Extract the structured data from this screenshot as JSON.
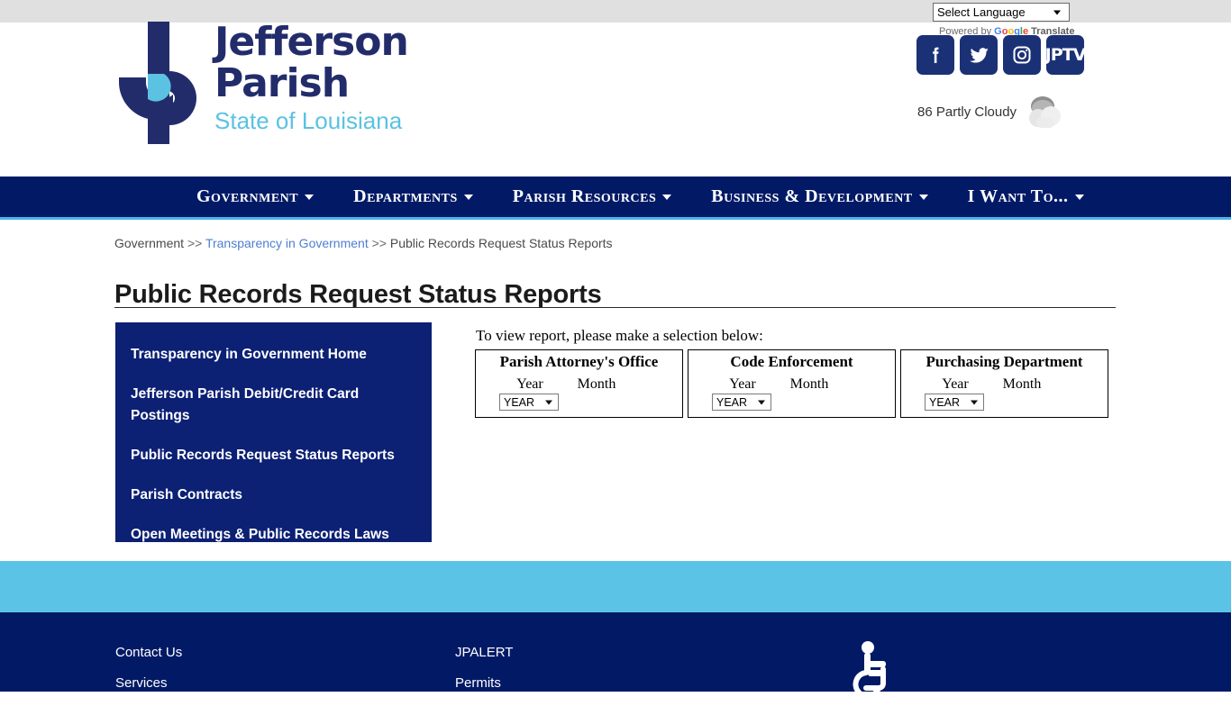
{
  "topbar": {
    "language_select": {
      "value": "Select Language",
      "icon": "chevron-down-icon"
    },
    "powered_by": {
      "prefix": "Powered by ",
      "brand_letters": [
        "G",
        "o",
        "o",
        "g",
        "l",
        "e"
      ],
      "suffix": " Translate"
    }
  },
  "logo": {
    "monogram": "JP",
    "line1": "Jefferson",
    "line2": "Parish",
    "line3": "State of Louisiana",
    "colors": {
      "navy": "#232c6b",
      "light_blue": "#5bc2e1"
    }
  },
  "social": [
    {
      "name": "facebook-icon",
      "label": "f"
    },
    {
      "name": "twitter-icon",
      "label": ""
    },
    {
      "name": "instagram-icon",
      "label": ""
    },
    {
      "name": "jptv-icon",
      "label": "JPTV"
    }
  ],
  "weather": {
    "temperature": "86",
    "condition": "Partly Cloudy",
    "text": "86 Partly Cloudy",
    "icon": "partly-cloudy-icon"
  },
  "nav": {
    "items": [
      {
        "label": "Government",
        "has_dropdown": true
      },
      {
        "label": "Departments",
        "has_dropdown": true
      },
      {
        "label": "Parish Resources",
        "has_dropdown": true
      },
      {
        "label": "Business & Development",
        "has_dropdown": true
      },
      {
        "label": "I Want To...",
        "has_dropdown": true
      }
    ],
    "bg": "#021a66",
    "accent": "#4ab5e8"
  },
  "breadcrumb": {
    "item1": "Government",
    "sep1": ">>",
    "item2": "Transparency in Government",
    "sep2": ">>",
    "item3": "Public Records Request Status Reports"
  },
  "page": {
    "title": "Public Records Request Status Reports"
  },
  "sidebar": {
    "items": [
      {
        "label": "Transparency in Government Home"
      },
      {
        "label": "Jefferson Parish Debit/Credit Card Postings"
      },
      {
        "label": "Public Records Request Status Reports"
      },
      {
        "label": "Parish Contracts"
      },
      {
        "label": "Open Meetings & Public Records Laws"
      }
    ],
    "bg": "#0c2074"
  },
  "main": {
    "intro": "To view report, please make a selection below:",
    "boxes": [
      {
        "title": "Parish Attorney's Office",
        "year_label": "Year",
        "month_label": "Month",
        "year_value": "YEAR"
      },
      {
        "title": "Code Enforcement",
        "year_label": "Year",
        "month_label": "Month",
        "year_value": "YEAR"
      },
      {
        "title": "Purchasing Department",
        "year_label": "Year",
        "month_label": "Month",
        "year_value": "YEAR"
      }
    ]
  },
  "footer": {
    "column1": [
      {
        "label": "Contact Us"
      },
      {
        "label": "Services"
      }
    ],
    "column2": [
      {
        "label": "JPALERT"
      },
      {
        "label": "Permits"
      }
    ],
    "accessibility_icon": "wheelchair-accessibility-icon",
    "bg": "#021a66",
    "band_color": "#5bc3e5"
  }
}
